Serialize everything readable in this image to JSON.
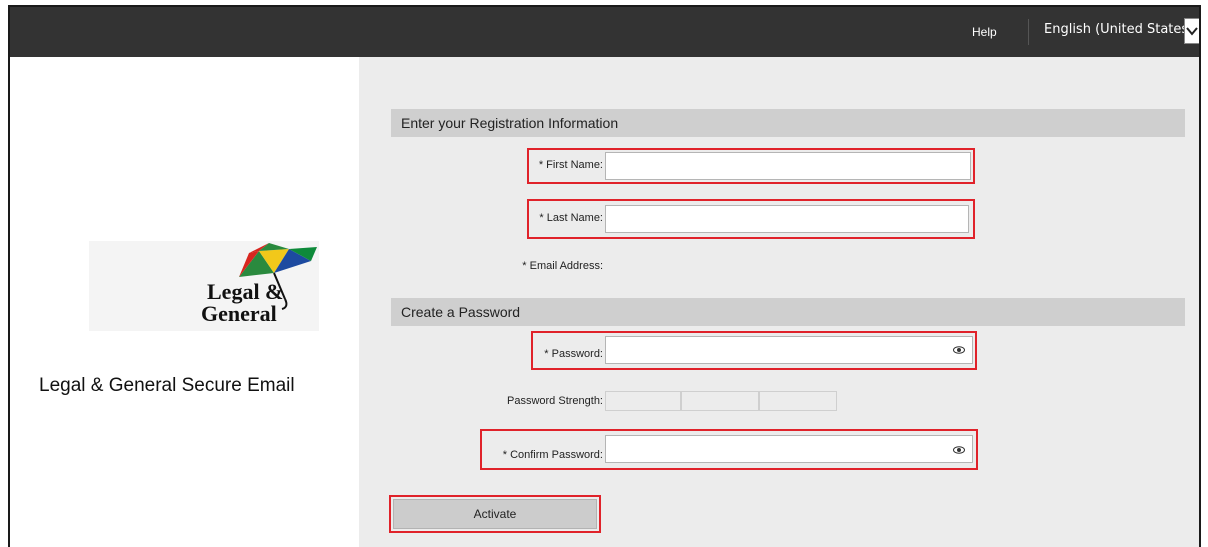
{
  "header": {
    "help_label": "Help",
    "language_label": "English (United States)"
  },
  "brand": {
    "title": "Legal & General Secure Email",
    "logo_line1": "Legal &",
    "logo_line2": "General"
  },
  "registration": {
    "section_title": "Enter your Registration Information",
    "first_name_label": "* First Name:",
    "first_name_value": "",
    "last_name_label": "* Last Name:",
    "last_name_value": "",
    "email_label": "* Email Address:",
    "email_value": ""
  },
  "password_section": {
    "section_title": "Create a Password",
    "password_label": "* Password:",
    "password_value": "",
    "strength_label": "Password Strength:",
    "confirm_label": "* Confirm Password:",
    "confirm_value": ""
  },
  "actions": {
    "activate_label": "Activate"
  },
  "colors": {
    "topbar": "#333333",
    "highlight": "#e0222a",
    "section_bg": "#cfcfcf",
    "panel_bg": "#ececec"
  }
}
